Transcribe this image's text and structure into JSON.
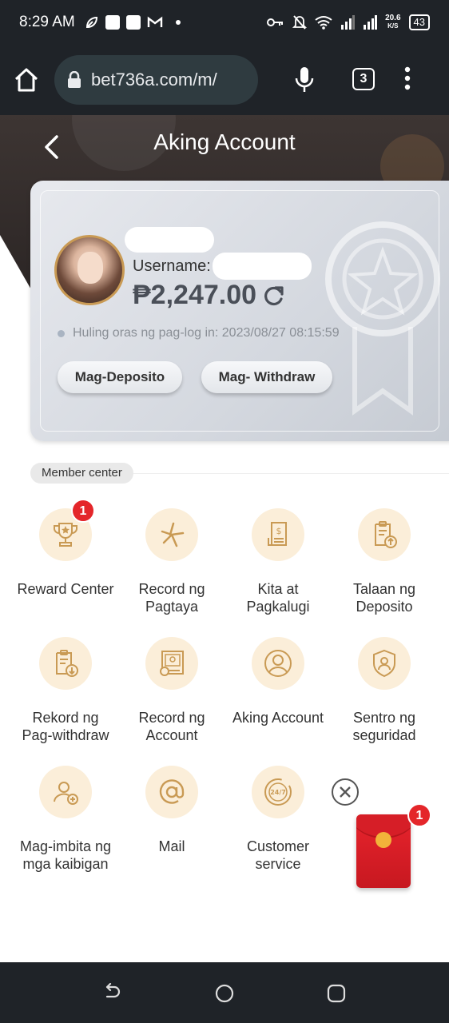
{
  "status_bar": {
    "time": "8:29 AM",
    "speed_value": "20.6",
    "speed_unit": "K/S",
    "battery": "43"
  },
  "browser": {
    "url": "bet736a.com/m/",
    "tab_count": "3"
  },
  "header": {
    "title": "Aking Account"
  },
  "account": {
    "username_label": "Username:",
    "balance": "₱2,247.00",
    "last_login": "Huling oras ng pag-log in: 2023/08/27 08:15:59",
    "deposit_button": "Mag-Deposito",
    "withdraw_button": "Mag- Withdraw"
  },
  "member_center": {
    "label": "Member center",
    "items": [
      {
        "label": "Reward Center",
        "icon": "trophy-icon",
        "badge": "1"
      },
      {
        "label": "Record ng\nPagtaya",
        "icon": "sparkle-icon"
      },
      {
        "label": "Kita at\nPagkalugi",
        "icon": "receipt-icon"
      },
      {
        "label": "Talaan ng\nDeposito",
        "icon": "clipboard-upload-icon"
      },
      {
        "label": "Rekord ng\nPag-withdraw",
        "icon": "clipboard-download-icon"
      },
      {
        "label": "Record ng\nAccount",
        "icon": "account-record-icon"
      },
      {
        "label": "Aking Account",
        "icon": "user-icon"
      },
      {
        "label": "Sentro ng\nseguridad",
        "icon": "shield-user-icon"
      },
      {
        "label": "Mag-imbita ng\nmga kaibigan",
        "icon": "invite-user-icon"
      },
      {
        "label": "Mail",
        "icon": "at-icon"
      },
      {
        "label": "Customer\nservice",
        "icon": "support-24-7-icon"
      }
    ]
  },
  "floating": {
    "red_envelope_badge": "1"
  },
  "colors": {
    "accent_gold": "#c99a54",
    "icon_bg": "#fbeed9",
    "badge_red": "#e4262a",
    "header_dark": "#3d3533"
  }
}
